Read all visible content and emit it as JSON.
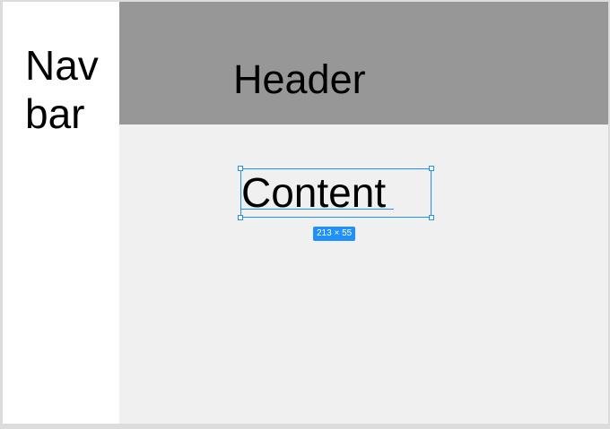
{
  "navbar": {
    "label": "Nav\nbar"
  },
  "header": {
    "label": "Header"
  },
  "content": {
    "label": "Content",
    "selection": {
      "dimensions_label": "213 × 55"
    }
  },
  "colors": {
    "navbar_bg": "#ffffff",
    "header_bg": "#979797",
    "content_bg": "#f0f0f0",
    "selection_accent": "#1e90ff"
  }
}
